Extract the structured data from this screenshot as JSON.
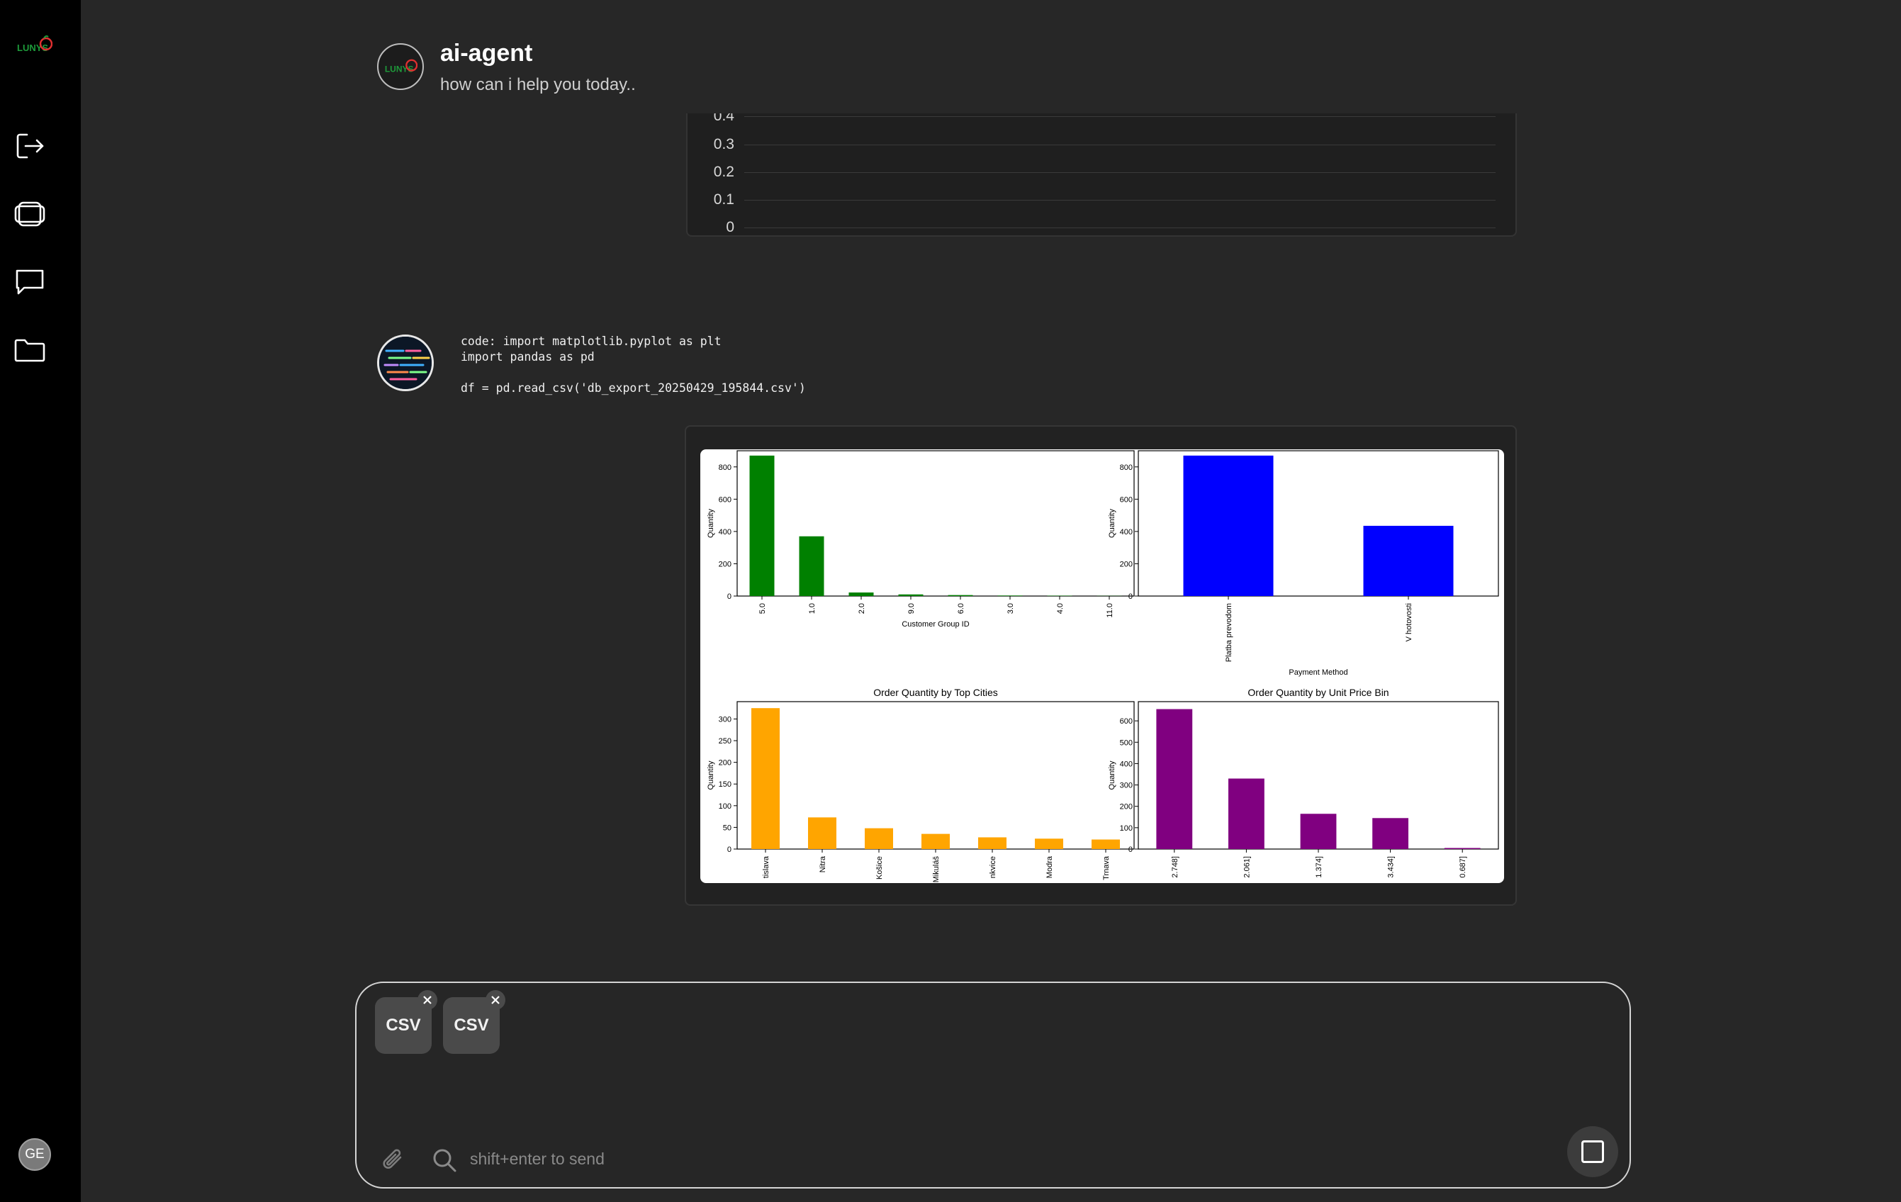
{
  "app": {
    "title": "ai-agent",
    "subtitle": "how can i help you today..",
    "brand_logo_text": "LUNYS"
  },
  "sidebar": {
    "items": [
      {
        "name": "logout",
        "icon": "logout-icon"
      },
      {
        "name": "workspaces",
        "icon": "layers-icon"
      },
      {
        "name": "chat",
        "icon": "chat-icon"
      },
      {
        "name": "files",
        "icon": "folder-icon"
      }
    ],
    "user_initials": "GE"
  },
  "previous_chart": {
    "ticks": [
      "0.4",
      "0.3",
      "0.2",
      "0.1",
      "0"
    ]
  },
  "message": {
    "code_lines": [
      "code: import matplotlib.pyplot as plt",
      "import pandas as pd",
      "",
      "df = pd.read_csv('db_export_20250429_195844.csv')"
    ]
  },
  "chart_data": [
    {
      "type": "bar",
      "title": "",
      "xlabel": "Customer Group ID",
      "ylabel": "Quantity",
      "categories": [
        "5.0",
        "1.0",
        "2.0",
        "9.0",
        "6.0",
        "3.0",
        "4.0",
        "11.0"
      ],
      "values": [
        870,
        370,
        22,
        10,
        6,
        3,
        2,
        1
      ],
      "ylim": [
        0,
        900
      ],
      "yticks": [
        0,
        200,
        400,
        600,
        800
      ],
      "color": "#008000"
    },
    {
      "type": "bar",
      "title": "",
      "xlabel": "Payment Method",
      "ylabel": "Quantity",
      "categories": [
        "Platba prevodom",
        "V hotovosti"
      ],
      "values": [
        870,
        435
      ],
      "ylim": [
        0,
        900
      ],
      "yticks": [
        0,
        200,
        400,
        600,
        800
      ],
      "color": "#0000ff"
    },
    {
      "type": "bar",
      "title": "Order Quantity by Top Cities",
      "xlabel": "",
      "ylabel": "Quantity",
      "categories": [
        "tislava",
        "Nitra",
        "Košice",
        "Mikuláš",
        "nkvice",
        "Modra",
        "Trnava"
      ],
      "values": [
        325,
        73,
        48,
        35,
        27,
        24,
        22
      ],
      "ylim": [
        0,
        340
      ],
      "yticks": [
        0,
        50,
        100,
        150,
        200,
        250,
        300
      ],
      "color": "#ffa500"
    },
    {
      "type": "bar",
      "title": "Order Quantity by Unit Price Bin",
      "xlabel": "",
      "ylabel": "Quantity",
      "categories": [
        "2.748]",
        "2.061]",
        "1.374]",
        "3.434]",
        "0.687]"
      ],
      "values": [
        655,
        330,
        165,
        145,
        5
      ],
      "ylim": [
        0,
        690
      ],
      "yticks": [
        0,
        100,
        200,
        300,
        400,
        500,
        600
      ],
      "color": "#800080"
    }
  ],
  "composer": {
    "attachments": [
      {
        "label": "CSV"
      },
      {
        "label": "CSV"
      }
    ],
    "placeholder": "shift+enter to send"
  },
  "colors": {
    "background": "#272727",
    "sidebar": "#000000",
    "green": "#008000",
    "blue": "#0000ff",
    "orange": "#ffa500",
    "purple": "#800080"
  }
}
